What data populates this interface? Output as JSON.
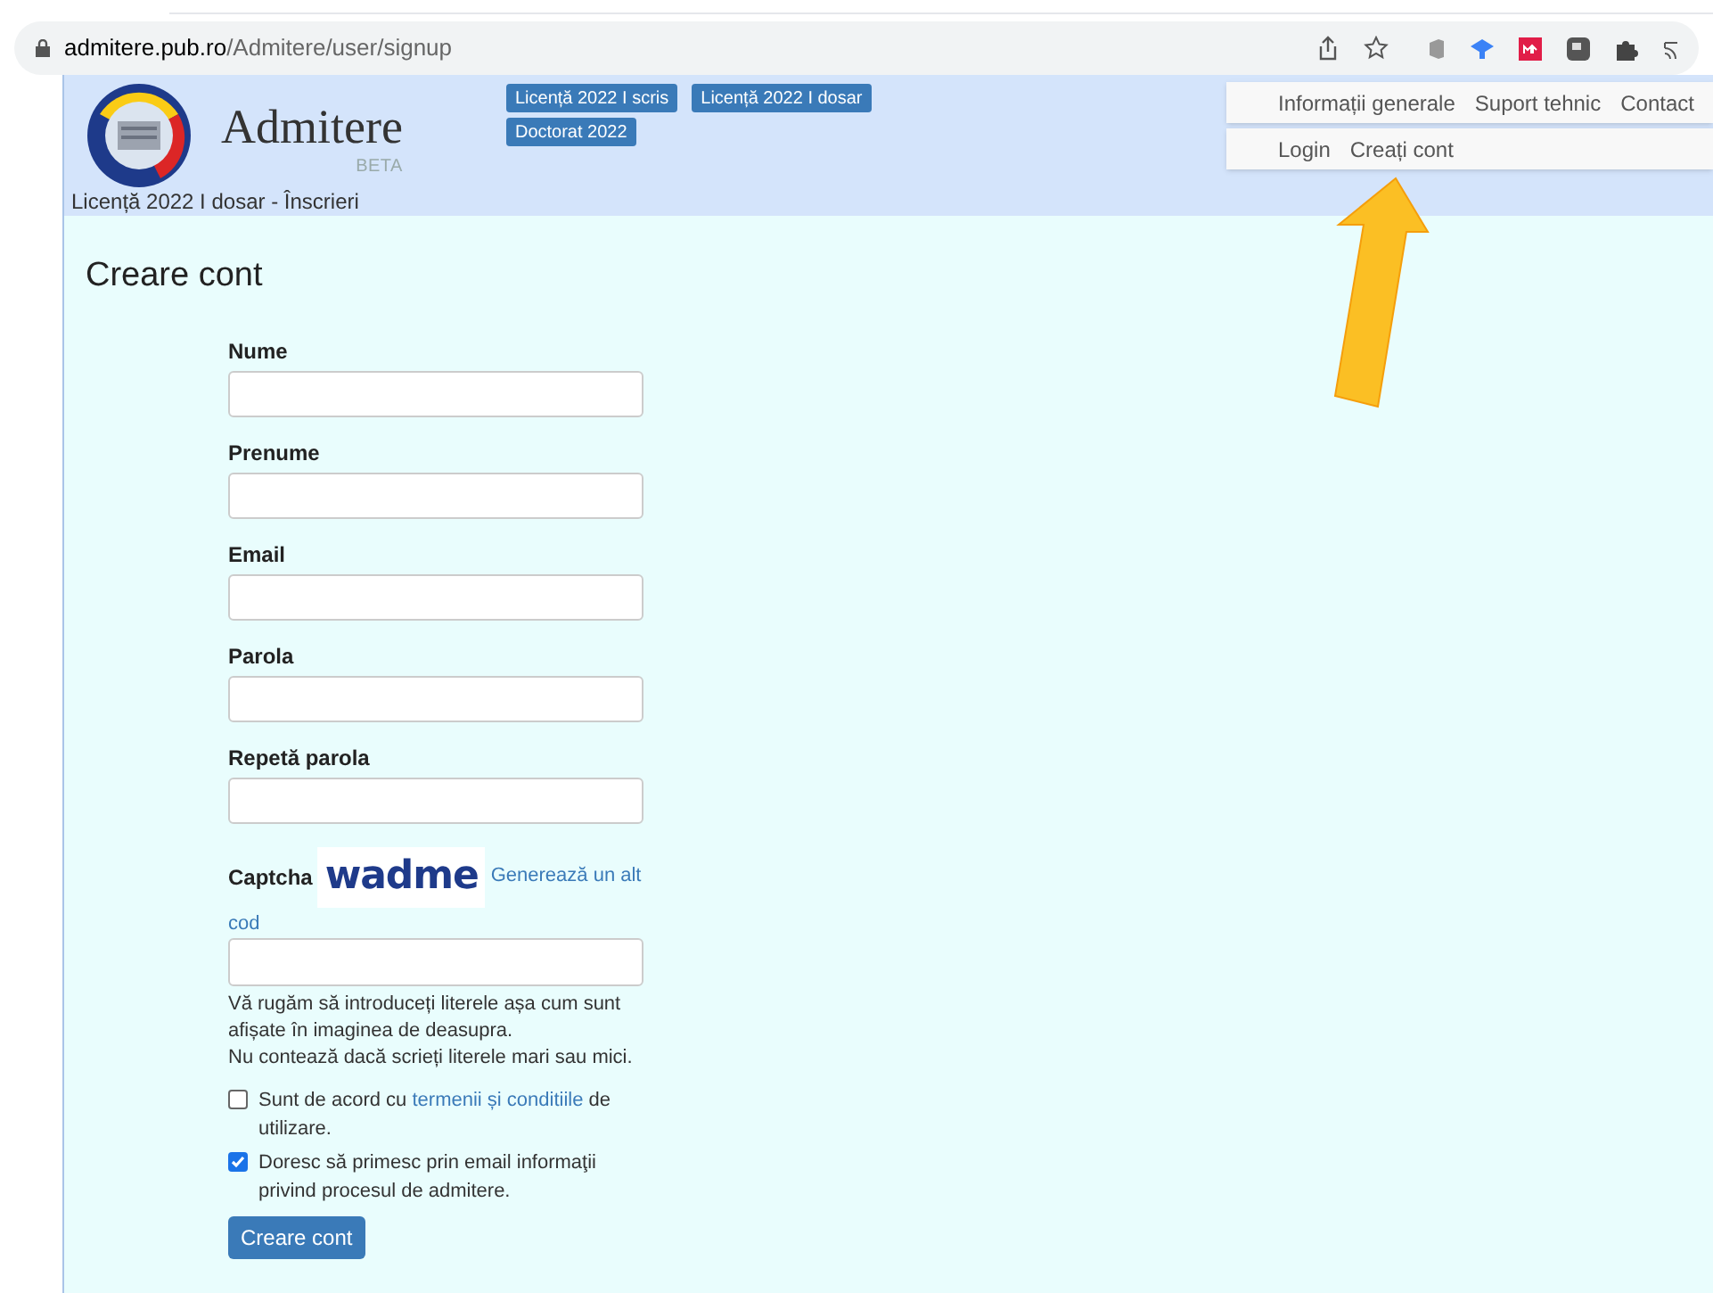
{
  "browser": {
    "url_host": "admitere.pub.ro",
    "url_path": "/Admitere/user/signup"
  },
  "header": {
    "site_title": "Admitere",
    "badge": "BETA",
    "subtitle": "Licență 2022 I dosar - Înscrieri",
    "session_buttons": [
      "Licență 2022 I scris",
      "Licență 2022 I dosar",
      "Doctorat 2022"
    ],
    "nav_top": [
      "Informații generale",
      "Suport tehnic",
      "Contact"
    ],
    "nav_bottom": [
      "Login",
      "Creați cont"
    ]
  },
  "page_title": "Creare cont",
  "fields": [
    {
      "label": "Nume"
    },
    {
      "label": "Prenume"
    },
    {
      "label": "Email"
    },
    {
      "label": "Parola"
    },
    {
      "label": "Repetă parola"
    }
  ],
  "captcha": {
    "label": "Captcha",
    "image_text": "wadme",
    "regenerate_link": [
      "Generează un alt",
      "cod"
    ],
    "help": [
      "Vă rugăm să introduceți literele așa cum sunt afișate în imaginea de deasupra.",
      "Nu contează dacă scrieți literele mari sau mici."
    ]
  },
  "checkboxes": [
    {
      "before": "Sunt de acord cu ",
      "link": "termenii și conditiile",
      "after": " de utilizare.",
      "checked": false
    },
    {
      "before": "Doresc să primesc prin email informaţii privind procesul de admitere.",
      "checked": true
    }
  ],
  "submit": "Creare cont"
}
